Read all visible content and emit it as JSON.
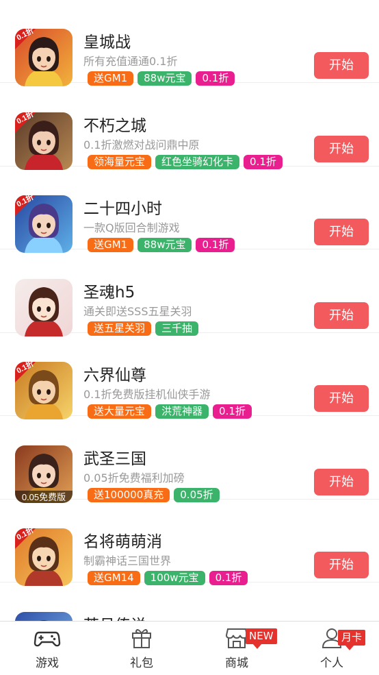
{
  "games": [
    {
      "title": "皇城战",
      "desc": "所有充值通通0.1折",
      "icon": "game-icon-huangchengzhan",
      "art": {
        "bg1": "#d94a2a",
        "bg2": "#f2b33c",
        "hair": "#2b1a17",
        "skin": "#f6d2b4",
        "accent": "#f5c842"
      },
      "ribbon": "0.1折",
      "tags": [
        {
          "text": "送GM1",
          "color": "#f96c16"
        },
        {
          "text": "88w元宝",
          "color": "#3cb36a"
        },
        {
          "text": "0.1折",
          "color": "#ea1f8f"
        }
      ],
      "button": "开始"
    },
    {
      "title": "不朽之城",
      "desc": "0.1折激燃对战问鼎中原",
      "icon": "game-icon-buxiuzhicheng",
      "art": {
        "bg1": "#5b3a2a",
        "bg2": "#b88a52",
        "hair": "#3a1e1a",
        "skin": "#f1cdb4",
        "accent": "#c8242c"
      },
      "ribbon": "0.1折",
      "tags": [
        {
          "text": "领海量元宝",
          "color": "#f96c16"
        },
        {
          "text": "红色坐骑幻化卡",
          "color": "#3cb36a"
        },
        {
          "text": "0.1折",
          "color": "#ea1f8f"
        }
      ],
      "button": "开始"
    },
    {
      "title": "二十四小时",
      "desc": "一款Q版回合制游戏",
      "icon": "game-icon-ershisixiaoshi",
      "art": {
        "bg1": "#2847a0",
        "bg2": "#5fb0e8",
        "hair": "#4a3a8a",
        "skin": "#f3d5c0",
        "accent": "#8ad0ff"
      },
      "ribbon": "0.1折",
      "tags": [
        {
          "text": "送GM1",
          "color": "#f96c16"
        },
        {
          "text": "88w元宝",
          "color": "#3cb36a"
        },
        {
          "text": "0.1折",
          "color": "#ea1f8f"
        }
      ],
      "button": "开始"
    },
    {
      "title": "圣魂h5",
      "desc": "通关即送SSS五星关羽",
      "icon": "game-icon-shenghun",
      "art": {
        "bg1": "#f5ecea",
        "bg2": "#f0d6d6",
        "hair": "#4a2418",
        "skin": "#fbe3d2",
        "accent": "#c52b2b"
      },
      "ribbon": "",
      "tags": [
        {
          "text": "送五星关羽",
          "color": "#f96c16"
        },
        {
          "text": "三千抽",
          "color": "#3cb36a"
        }
      ],
      "button": "开始"
    },
    {
      "title": "六界仙尊",
      "desc": "0.1折免费版挂机仙侠手游",
      "icon": "game-icon-liujiexianzun",
      "art": {
        "bg1": "#c97a22",
        "bg2": "#f6d36a",
        "hair": "#7a4a1a",
        "skin": "#f5d2ae",
        "accent": "#e9a52f"
      },
      "ribbon": "0.1折",
      "tags": [
        {
          "text": "送大量元宝",
          "color": "#f96c16"
        },
        {
          "text": "洪荒神器",
          "color": "#3cb36a"
        },
        {
          "text": "0.1折",
          "color": "#ea1f8f"
        }
      ],
      "button": "开始"
    },
    {
      "title": "武圣三国",
      "desc": "0.05折免费福利加磅",
      "icon": "game-icon-wushengsanguo",
      "art": {
        "bg1": "#8a3a1e",
        "bg2": "#e2a055",
        "hair": "#3b221a",
        "skin": "#f6d6be",
        "accent": "#d3902e"
      },
      "ribbon": "",
      "caption": "0.05免费版",
      "tags": [
        {
          "text": "送100000真充",
          "color": "#f96c16"
        },
        {
          "text": "0.05折",
          "color": "#3cb36a"
        }
      ],
      "button": "开始"
    },
    {
      "title": "名将萌萌消",
      "desc": "制霸神话三国世界",
      "icon": "game-icon-mingjiangmengmengxiao",
      "art": {
        "bg1": "#e07a2a",
        "bg2": "#f6c35a",
        "hair": "#5a3018",
        "skin": "#f7d6b4",
        "accent": "#b0392a"
      },
      "ribbon": "0.1折",
      "tags": [
        {
          "text": "送GM14",
          "color": "#f96c16"
        },
        {
          "text": "100w元宝",
          "color": "#3cb36a"
        },
        {
          "text": "0.1折",
          "color": "#ea1f8f"
        }
      ],
      "button": "开始"
    },
    {
      "title": "苍月传说",
      "desc": "",
      "icon": "game-icon-partial",
      "art": {
        "bg1": "#2e4fa8",
        "bg2": "#7fb8ea",
        "hair": "#2a2a4a",
        "skin": "#f3d5c0",
        "accent": "#8ad0ff"
      },
      "ribbon": "",
      "tags": [],
      "button": ""
    }
  ],
  "tabbar": {
    "tabs": [
      {
        "label": "游戏",
        "icon": "gamepad-icon",
        "badge": ""
      },
      {
        "label": "礼包",
        "icon": "gift-icon",
        "badge": ""
      },
      {
        "label": "商城",
        "icon": "store-icon",
        "badge": "NEW"
      },
      {
        "label": "个人",
        "icon": "person-icon",
        "badge": "月卡"
      }
    ]
  }
}
